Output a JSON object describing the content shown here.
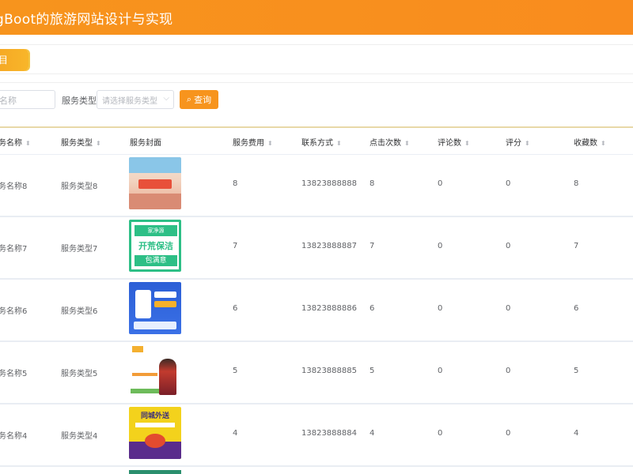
{
  "header": {
    "title": "gBoot的旅游网站设计与实现"
  },
  "tabs": [
    {
      "label": "目"
    }
  ],
  "search": {
    "name_placeholder": "名称",
    "type_label": "服务类型",
    "type_placeholder": "请选择服务类型",
    "query_button": "查询"
  },
  "table": {
    "columns": [
      "务名称",
      "服务类型",
      "服务封面",
      "服务费用",
      "联系方式",
      "点击次数",
      "评论数",
      "评分",
      "收藏数"
    ],
    "rows": [
      {
        "name": "务名称8",
        "type": "服务类型8",
        "fee": "8",
        "phone": "13823888888",
        "clicks": "8",
        "comments": "0",
        "rating": "0",
        "favorites": "8",
        "cover": "cover-travel-poster"
      },
      {
        "name": "务名称7",
        "type": "服务类型7",
        "fee": "7",
        "phone": "13823888887",
        "clicks": "7",
        "comments": "0",
        "rating": "0",
        "favorites": "7",
        "cover": "cover-cleaning-poster"
      },
      {
        "name": "务名称6",
        "type": "服务类型6",
        "fee": "6",
        "phone": "13823888886",
        "clicks": "6",
        "comments": "0",
        "rating": "0",
        "favorites": "6",
        "cover": "cover-app-poster"
      },
      {
        "name": "务名称5",
        "type": "服务类型5",
        "fee": "5",
        "phone": "13823888885",
        "clicks": "5",
        "comments": "0",
        "rating": "0",
        "favorites": "5",
        "cover": "cover-person-poster"
      },
      {
        "name": "务名称4",
        "type": "服务类型4",
        "fee": "4",
        "phone": "13823888884",
        "clicks": "4",
        "comments": "0",
        "rating": "0",
        "favorites": "4",
        "cover": "cover-delivery-poster"
      }
    ],
    "cover_text": {
      "r2_top": "家净源",
      "r2_mid": "开荒保洁",
      "r2_bot": "包满意",
      "r5_head": "同城外送"
    }
  },
  "icons": {
    "query": "search-icon",
    "sort": "sort-caret-icon",
    "select": "chevron-down-icon"
  },
  "colors": {
    "accent": "#f7941d",
    "header": "#f7941d"
  }
}
